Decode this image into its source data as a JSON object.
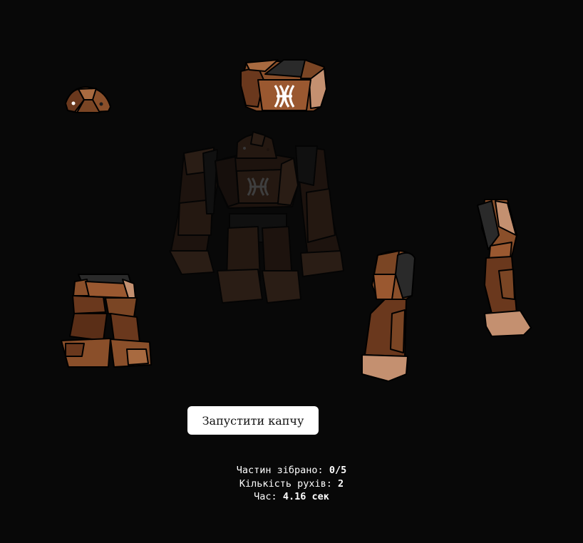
{
  "game": {
    "start_button_label": "Запустити капчу",
    "stats": {
      "parts_label": "Частин зібрано:",
      "parts_value": "0/5",
      "moves_label": "Кількість рухів:",
      "moves_value": "2",
      "time_label": "Час:",
      "time_value": "4.16 сек"
    },
    "pieces": [
      {
        "name": "head-piece",
        "label": "head"
      },
      {
        "name": "torso-piece",
        "label": "torso"
      },
      {
        "name": "legs-piece",
        "label": "legs"
      },
      {
        "name": "left-arm-piece",
        "label": "left-arm"
      },
      {
        "name": "right-arm-piece",
        "label": "right-arm"
      }
    ],
    "colors": {
      "background": "#080808",
      "stone_dark": "#5a2e17",
      "stone_mid": "#8a4f2a",
      "stone_light": "#c49070",
      "stone_black": "#2a2a2a",
      "outline": "#000000"
    }
  }
}
